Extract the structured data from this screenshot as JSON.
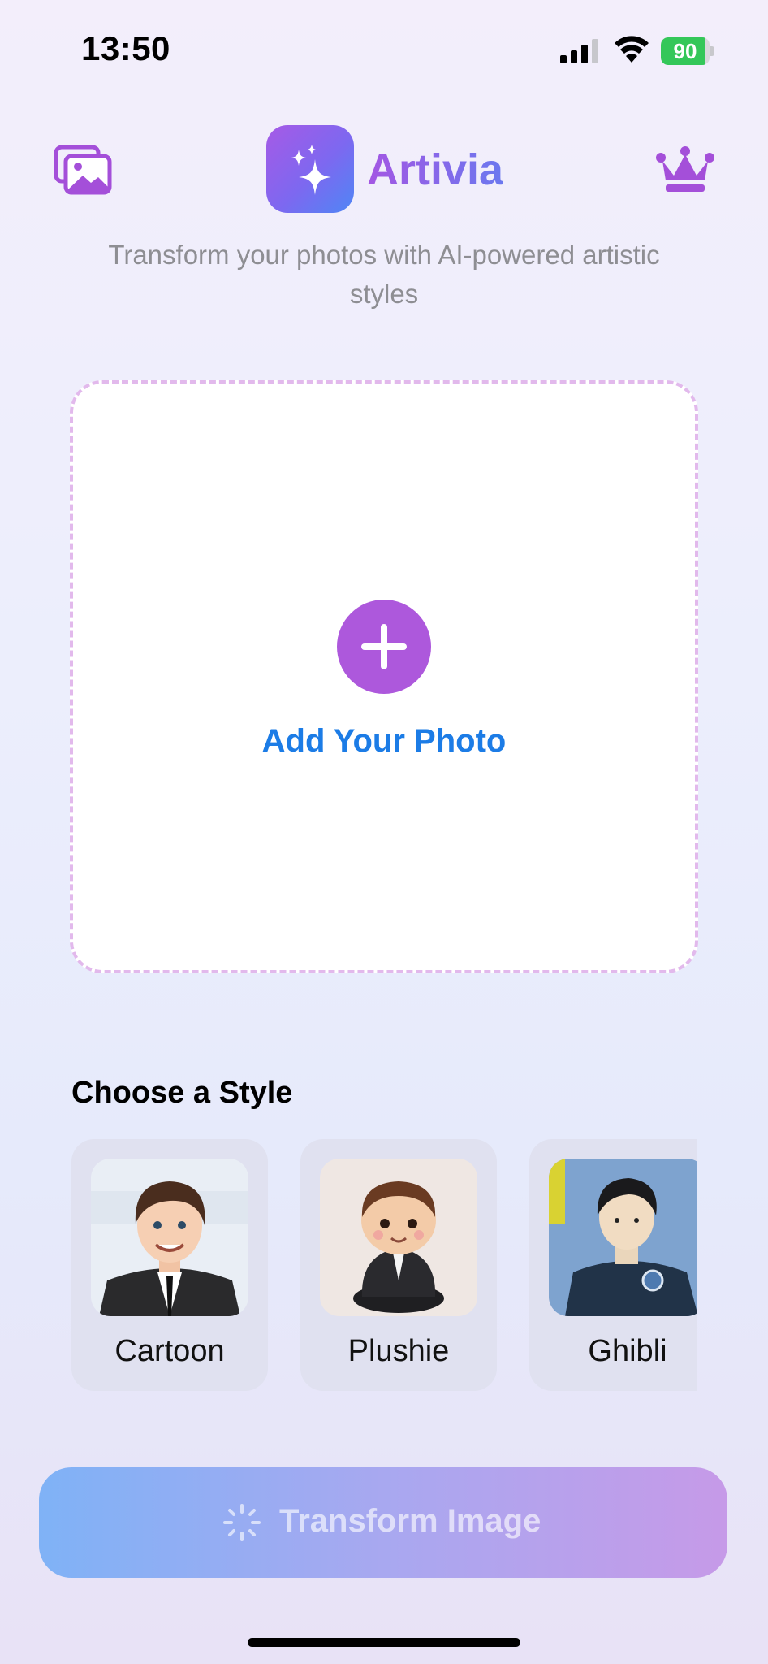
{
  "status_bar": {
    "time": "13:50",
    "battery_level": 90,
    "battery_text": "90"
  },
  "header": {
    "app_name": "Artivia",
    "subtitle": "Transform your photos with AI-powered artistic styles",
    "left_icon": "photo-gallery-icon",
    "right_icon": "crown-icon",
    "logo_icon": "sparkles-icon"
  },
  "upload": {
    "label": "Add Your Photo",
    "icon": "plus-icon"
  },
  "styles": {
    "title": "Choose a Style",
    "items": [
      {
        "label": "Cartoon"
      },
      {
        "label": "Plushie"
      },
      {
        "label": "Ghibli"
      }
    ]
  },
  "transform_button": {
    "label": "Transform Image",
    "icon": "magic-wand-icon"
  },
  "colors": {
    "accent_purple": "#ad58dc",
    "link_blue": "#1c7ce6",
    "battery_green": "#34c759"
  }
}
